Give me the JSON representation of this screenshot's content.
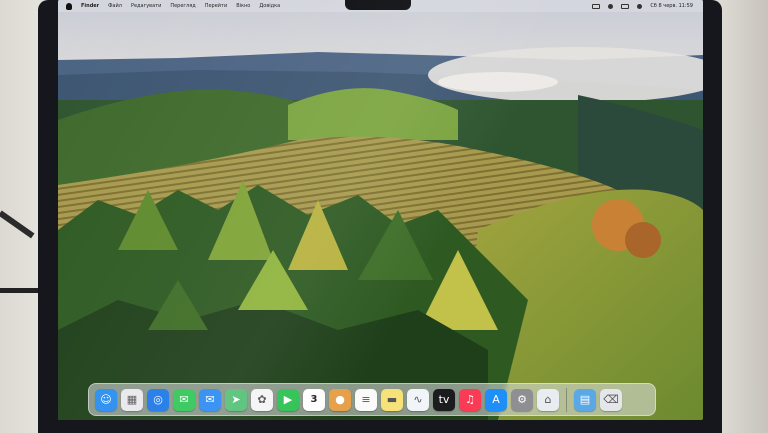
{
  "menubar": {
    "items": [
      "Finder",
      "Файл",
      "Редагувати",
      "Перегляд",
      "Перейти",
      "Вікно",
      "Довідка"
    ],
    "clock": "Сб 8 черв. 11:59"
  },
  "dock": {
    "apps": [
      {
        "name": "finder-icon",
        "color": "#2a8ef0",
        "glyph": "☺"
      },
      {
        "name": "launchpad-icon",
        "color": "#e9e9ee",
        "glyph": "▦"
      },
      {
        "name": "safari-icon",
        "color": "#1f7ae8",
        "glyph": "◎"
      },
      {
        "name": "messages-icon",
        "color": "#34c759",
        "glyph": "✉"
      },
      {
        "name": "mail-icon",
        "color": "#2f8cf2",
        "glyph": "✉"
      },
      {
        "name": "maps-icon",
        "color": "#57c27a",
        "glyph": "➤"
      },
      {
        "name": "photos-icon",
        "color": "#f5f5f5",
        "glyph": "✿"
      },
      {
        "name": "facetime-icon",
        "color": "#30c255",
        "glyph": "▶"
      },
      {
        "name": "calendar-icon",
        "color": "#ffffff",
        "glyph": "3"
      },
      {
        "name": "contacts-icon",
        "color": "#e6a04a",
        "glyph": "●"
      },
      {
        "name": "reminders-icon",
        "color": "#fafafa",
        "glyph": "≡"
      },
      {
        "name": "notes-icon",
        "color": "#f7e27a",
        "glyph": "▬"
      },
      {
        "name": "freeform-icon",
        "color": "#f1f4f8",
        "glyph": "∿"
      },
      {
        "name": "tv-icon",
        "color": "#1c1c1e",
        "glyph": "tv"
      },
      {
        "name": "music-icon",
        "color": "#fa3b55",
        "glyph": "♫"
      },
      {
        "name": "app-store-icon",
        "color": "#1e8ff7",
        "glyph": "A"
      },
      {
        "name": "system-settings-icon",
        "color": "#8e8e93",
        "glyph": "⚙"
      },
      {
        "name": "preview-icon",
        "color": "#e9ecf0",
        "glyph": "⌂"
      },
      {
        "name": "downloads-folder-icon",
        "color": "#5aa9e6",
        "glyph": "▤"
      },
      {
        "name": "trash-icon",
        "color": "#e4e6ea",
        "glyph": "⌫"
      }
    ],
    "calendar_day": "3"
  }
}
